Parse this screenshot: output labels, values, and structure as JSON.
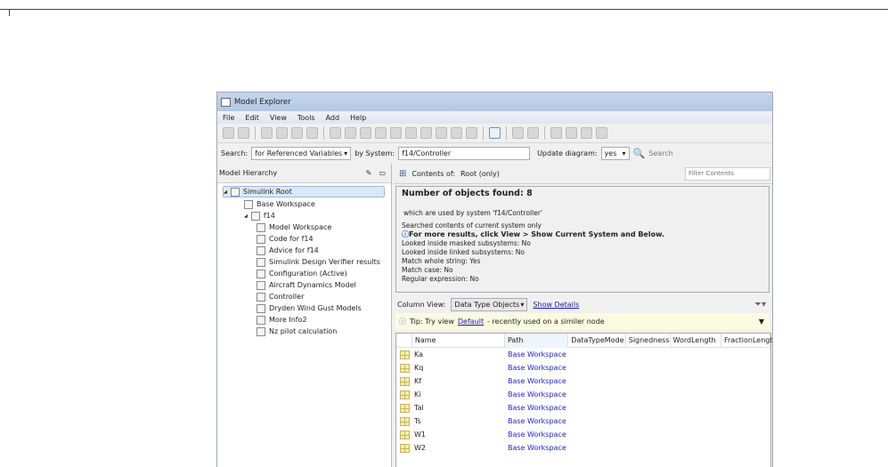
{
  "window": {
    "title": "Model Explorer"
  },
  "menu": [
    "File",
    "Edit",
    "View",
    "Tools",
    "Add",
    "Help"
  ],
  "search": {
    "label": "Search:",
    "type": "for Referenced Variables",
    "by_system_label": "by System:",
    "system": "f14/Controller",
    "update_label": "Update diagram:",
    "update_value": "yes",
    "search_button": "Search"
  },
  "hierarchy": {
    "title": "Model Hierarchy",
    "items": [
      {
        "label": "Simulink Root",
        "level": 0,
        "selected": true
      },
      {
        "label": "Base Workspace",
        "level": 1
      },
      {
        "label": "f14",
        "level": 1
      },
      {
        "label": "Model Workspace",
        "level": 2
      },
      {
        "label": "Code for f14",
        "level": 2
      },
      {
        "label": "Advice for f14",
        "level": 2
      },
      {
        "label": "Simulink Design Verifier results",
        "level": 2
      },
      {
        "label": "Configuration (Active)",
        "level": 2
      },
      {
        "label": "Aircraft Dynamics Model",
        "level": 2
      },
      {
        "label": "Controller",
        "level": 2
      },
      {
        "label": "Dryden Wind Gust Models",
        "level": 2
      },
      {
        "label": "More Info2",
        "level": 2
      },
      {
        "label": "Nz pilot calculation",
        "level": 2
      }
    ]
  },
  "contents": {
    "label": "Contents of:",
    "scope": "Root  (only)",
    "filter_placeholder": "Filter Contents"
  },
  "info": {
    "count": "Number of objects found: 8",
    "used_by": "which are used by system 'f14/Controller'",
    "searched": "Searched contents of current system only",
    "more": "For more results, click View > Show Current System and Below.",
    "masked": "Looked inside masked subsystems: No",
    "linked": "Looked inside linked subsystems: No",
    "whole": "Match whole string: Yes",
    "case": "Match case: No",
    "regex": "Regular expression: No"
  },
  "column_view": {
    "label": "Column View:",
    "value": "Data Type Objects",
    "details": "Show Details"
  },
  "tip": {
    "prefix": "Tip: Try view",
    "link": "Default",
    "suffix": "- recently used on a similer node"
  },
  "table": {
    "columns": [
      "Name",
      "Path",
      "DataTypeMode",
      "Signedness",
      "WordLength",
      "FractionLength"
    ],
    "rows": [
      {
        "name": "Ka",
        "path": "Base Workspace"
      },
      {
        "name": "Kq",
        "path": "Base Workspace"
      },
      {
        "name": "Kf",
        "path": "Base Workspace"
      },
      {
        "name": "Ki",
        "path": "Base Workspace"
      },
      {
        "name": "Tal",
        "path": "Base Workspace"
      },
      {
        "name": "Ts",
        "path": "Base Workspace"
      },
      {
        "name": "W1",
        "path": "Base Workspace"
      },
      {
        "name": "W2",
        "path": "Base Workspace"
      }
    ]
  }
}
